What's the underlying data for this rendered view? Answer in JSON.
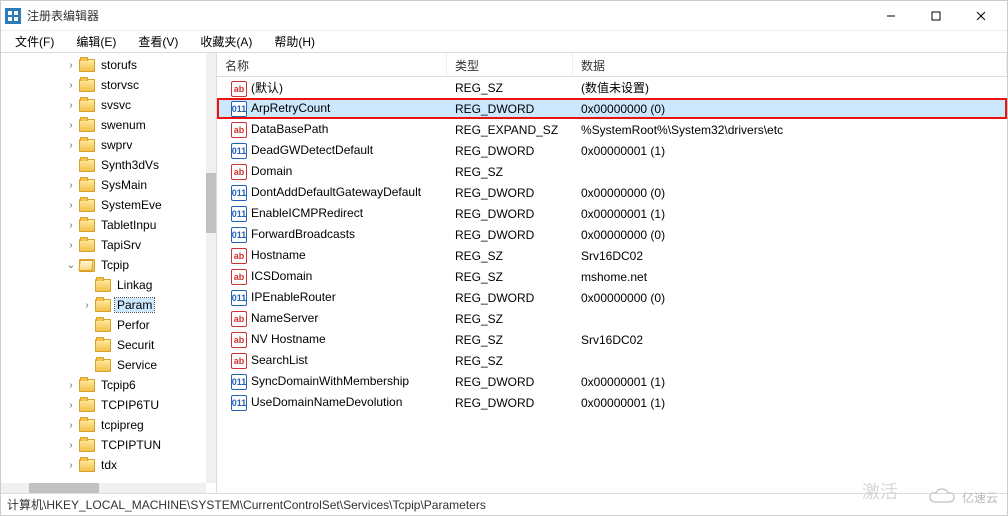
{
  "window": {
    "title": "注册表编辑器"
  },
  "menu": {
    "file": "文件(F)",
    "edit": "编辑(E)",
    "view": "查看(V)",
    "favorites": "收藏夹(A)",
    "help": "帮助(H)"
  },
  "columns": {
    "name": "名称",
    "type": "类型",
    "data": "数据"
  },
  "tree": [
    {
      "indent": 4,
      "expander": ">",
      "icon": "closed",
      "label": "storufs"
    },
    {
      "indent": 4,
      "expander": ">",
      "icon": "closed",
      "label": "storvsc"
    },
    {
      "indent": 4,
      "expander": ">",
      "icon": "closed",
      "label": "svsvc"
    },
    {
      "indent": 4,
      "expander": ">",
      "icon": "closed",
      "label": "swenum"
    },
    {
      "indent": 4,
      "expander": ">",
      "icon": "closed",
      "label": "swprv"
    },
    {
      "indent": 4,
      "expander": "",
      "icon": "closed",
      "label": "Synth3dVs"
    },
    {
      "indent": 4,
      "expander": ">",
      "icon": "closed",
      "label": "SysMain"
    },
    {
      "indent": 4,
      "expander": ">",
      "icon": "closed",
      "label": "SystemEve"
    },
    {
      "indent": 4,
      "expander": ">",
      "icon": "closed",
      "label": "TabletInpu"
    },
    {
      "indent": 4,
      "expander": ">",
      "icon": "closed",
      "label": "TapiSrv"
    },
    {
      "indent": 4,
      "expander": "v",
      "icon": "open",
      "label": "Tcpip"
    },
    {
      "indent": 5,
      "expander": "",
      "icon": "closed",
      "label": "Linkag"
    },
    {
      "indent": 5,
      "expander": ">",
      "icon": "closed",
      "label": "Param",
      "selected": true
    },
    {
      "indent": 5,
      "expander": "",
      "icon": "closed",
      "label": "Perfor"
    },
    {
      "indent": 5,
      "expander": "",
      "icon": "closed",
      "label": "Securit"
    },
    {
      "indent": 5,
      "expander": "",
      "icon": "closed",
      "label": "Service"
    },
    {
      "indent": 4,
      "expander": ">",
      "icon": "closed",
      "label": "Tcpip6"
    },
    {
      "indent": 4,
      "expander": ">",
      "icon": "closed",
      "label": "TCPIP6TU"
    },
    {
      "indent": 4,
      "expander": ">",
      "icon": "closed",
      "label": "tcpipreg"
    },
    {
      "indent": 4,
      "expander": ">",
      "icon": "closed",
      "label": "TCPIPTUN"
    },
    {
      "indent": 4,
      "expander": ">",
      "icon": "closed",
      "label": "tdx"
    }
  ],
  "values": [
    {
      "icon": "str",
      "name": "(默认)",
      "type": "REG_SZ",
      "data": "(数值未设置)"
    },
    {
      "icon": "dword",
      "name": "ArpRetryCount",
      "type": "REG_DWORD",
      "data": "0x00000000 (0)",
      "selected": true,
      "highlighted": true
    },
    {
      "icon": "str",
      "name": "DataBasePath",
      "type": "REG_EXPAND_SZ",
      "data": "%SystemRoot%\\System32\\drivers\\etc"
    },
    {
      "icon": "dword",
      "name": "DeadGWDetectDefault",
      "type": "REG_DWORD",
      "data": "0x00000001 (1)"
    },
    {
      "icon": "str",
      "name": "Domain",
      "type": "REG_SZ",
      "data": ""
    },
    {
      "icon": "dword",
      "name": "DontAddDefaultGatewayDefault",
      "type": "REG_DWORD",
      "data": "0x00000000 (0)"
    },
    {
      "icon": "dword",
      "name": "EnableICMPRedirect",
      "type": "REG_DWORD",
      "data": "0x00000001 (1)"
    },
    {
      "icon": "dword",
      "name": "ForwardBroadcasts",
      "type": "REG_DWORD",
      "data": "0x00000000 (0)"
    },
    {
      "icon": "str",
      "name": "Hostname",
      "type": "REG_SZ",
      "data": "Srv16DC02"
    },
    {
      "icon": "str",
      "name": "ICSDomain",
      "type": "REG_SZ",
      "data": "mshome.net"
    },
    {
      "icon": "dword",
      "name": "IPEnableRouter",
      "type": "REG_DWORD",
      "data": "0x00000000 (0)"
    },
    {
      "icon": "str",
      "name": "NameServer",
      "type": "REG_SZ",
      "data": ""
    },
    {
      "icon": "str",
      "name": "NV Hostname",
      "type": "REG_SZ",
      "data": "Srv16DC02"
    },
    {
      "icon": "str",
      "name": "SearchList",
      "type": "REG_SZ",
      "data": ""
    },
    {
      "icon": "dword",
      "name": "SyncDomainWithMembership",
      "type": "REG_DWORD",
      "data": "0x00000001 (1)"
    },
    {
      "icon": "dword",
      "name": "UseDomainNameDevolution",
      "type": "REG_DWORD",
      "data": "0x00000001 (1)"
    }
  ],
  "statusbar": {
    "path": "计算机\\HKEY_LOCAL_MACHINE\\SYSTEM\\CurrentControlSet\\Services\\Tcpip\\Parameters"
  },
  "icons": {
    "str_label": "ab",
    "dword_label": "011"
  },
  "watermark": {
    "activate": "激活",
    "brand": "亿速云"
  }
}
